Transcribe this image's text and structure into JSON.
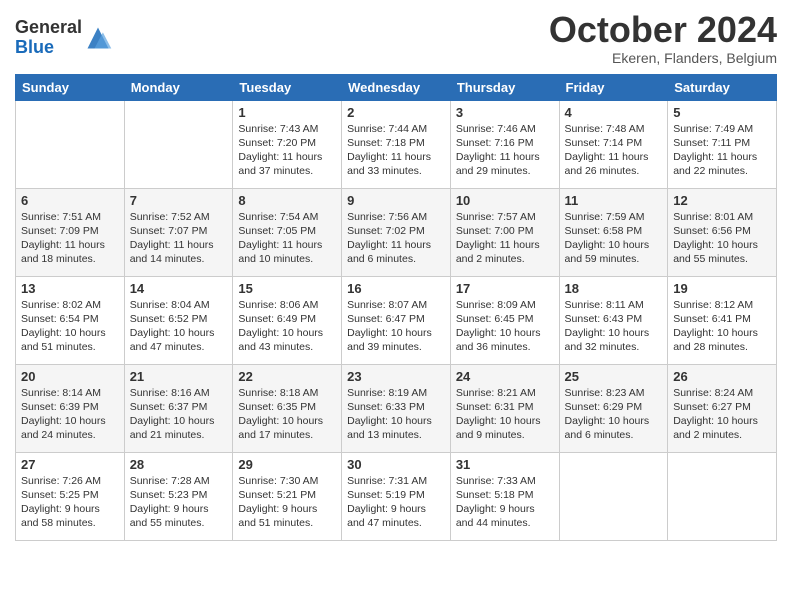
{
  "logo": {
    "general": "General",
    "blue": "Blue"
  },
  "title": "October 2024",
  "location": "Ekeren, Flanders, Belgium",
  "days": [
    "Sunday",
    "Monday",
    "Tuesday",
    "Wednesday",
    "Thursday",
    "Friday",
    "Saturday"
  ],
  "weeks": [
    [
      {
        "day": "",
        "content": ""
      },
      {
        "day": "",
        "content": ""
      },
      {
        "day": "1",
        "content": "Sunrise: 7:43 AM\nSunset: 7:20 PM\nDaylight: 11 hours and 37 minutes."
      },
      {
        "day": "2",
        "content": "Sunrise: 7:44 AM\nSunset: 7:18 PM\nDaylight: 11 hours and 33 minutes."
      },
      {
        "day": "3",
        "content": "Sunrise: 7:46 AM\nSunset: 7:16 PM\nDaylight: 11 hours and 29 minutes."
      },
      {
        "day": "4",
        "content": "Sunrise: 7:48 AM\nSunset: 7:14 PM\nDaylight: 11 hours and 26 minutes."
      },
      {
        "day": "5",
        "content": "Sunrise: 7:49 AM\nSunset: 7:11 PM\nDaylight: 11 hours and 22 minutes."
      }
    ],
    [
      {
        "day": "6",
        "content": "Sunrise: 7:51 AM\nSunset: 7:09 PM\nDaylight: 11 hours and 18 minutes."
      },
      {
        "day": "7",
        "content": "Sunrise: 7:52 AM\nSunset: 7:07 PM\nDaylight: 11 hours and 14 minutes."
      },
      {
        "day": "8",
        "content": "Sunrise: 7:54 AM\nSunset: 7:05 PM\nDaylight: 11 hours and 10 minutes."
      },
      {
        "day": "9",
        "content": "Sunrise: 7:56 AM\nSunset: 7:02 PM\nDaylight: 11 hours and 6 minutes."
      },
      {
        "day": "10",
        "content": "Sunrise: 7:57 AM\nSunset: 7:00 PM\nDaylight: 11 hours and 2 minutes."
      },
      {
        "day": "11",
        "content": "Sunrise: 7:59 AM\nSunset: 6:58 PM\nDaylight: 10 hours and 59 minutes."
      },
      {
        "day": "12",
        "content": "Sunrise: 8:01 AM\nSunset: 6:56 PM\nDaylight: 10 hours and 55 minutes."
      }
    ],
    [
      {
        "day": "13",
        "content": "Sunrise: 8:02 AM\nSunset: 6:54 PM\nDaylight: 10 hours and 51 minutes."
      },
      {
        "day": "14",
        "content": "Sunrise: 8:04 AM\nSunset: 6:52 PM\nDaylight: 10 hours and 47 minutes."
      },
      {
        "day": "15",
        "content": "Sunrise: 8:06 AM\nSunset: 6:49 PM\nDaylight: 10 hours and 43 minutes."
      },
      {
        "day": "16",
        "content": "Sunrise: 8:07 AM\nSunset: 6:47 PM\nDaylight: 10 hours and 39 minutes."
      },
      {
        "day": "17",
        "content": "Sunrise: 8:09 AM\nSunset: 6:45 PM\nDaylight: 10 hours and 36 minutes."
      },
      {
        "day": "18",
        "content": "Sunrise: 8:11 AM\nSunset: 6:43 PM\nDaylight: 10 hours and 32 minutes."
      },
      {
        "day": "19",
        "content": "Sunrise: 8:12 AM\nSunset: 6:41 PM\nDaylight: 10 hours and 28 minutes."
      }
    ],
    [
      {
        "day": "20",
        "content": "Sunrise: 8:14 AM\nSunset: 6:39 PM\nDaylight: 10 hours and 24 minutes."
      },
      {
        "day": "21",
        "content": "Sunrise: 8:16 AM\nSunset: 6:37 PM\nDaylight: 10 hours and 21 minutes."
      },
      {
        "day": "22",
        "content": "Sunrise: 8:18 AM\nSunset: 6:35 PM\nDaylight: 10 hours and 17 minutes."
      },
      {
        "day": "23",
        "content": "Sunrise: 8:19 AM\nSunset: 6:33 PM\nDaylight: 10 hours and 13 minutes."
      },
      {
        "day": "24",
        "content": "Sunrise: 8:21 AM\nSunset: 6:31 PM\nDaylight: 10 hours and 9 minutes."
      },
      {
        "day": "25",
        "content": "Sunrise: 8:23 AM\nSunset: 6:29 PM\nDaylight: 10 hours and 6 minutes."
      },
      {
        "day": "26",
        "content": "Sunrise: 8:24 AM\nSunset: 6:27 PM\nDaylight: 10 hours and 2 minutes."
      }
    ],
    [
      {
        "day": "27",
        "content": "Sunrise: 7:26 AM\nSunset: 5:25 PM\nDaylight: 9 hours and 58 minutes."
      },
      {
        "day": "28",
        "content": "Sunrise: 7:28 AM\nSunset: 5:23 PM\nDaylight: 9 hours and 55 minutes."
      },
      {
        "day": "29",
        "content": "Sunrise: 7:30 AM\nSunset: 5:21 PM\nDaylight: 9 hours and 51 minutes."
      },
      {
        "day": "30",
        "content": "Sunrise: 7:31 AM\nSunset: 5:19 PM\nDaylight: 9 hours and 47 minutes."
      },
      {
        "day": "31",
        "content": "Sunrise: 7:33 AM\nSunset: 5:18 PM\nDaylight: 9 hours and 44 minutes."
      },
      {
        "day": "",
        "content": ""
      },
      {
        "day": "",
        "content": ""
      }
    ]
  ]
}
